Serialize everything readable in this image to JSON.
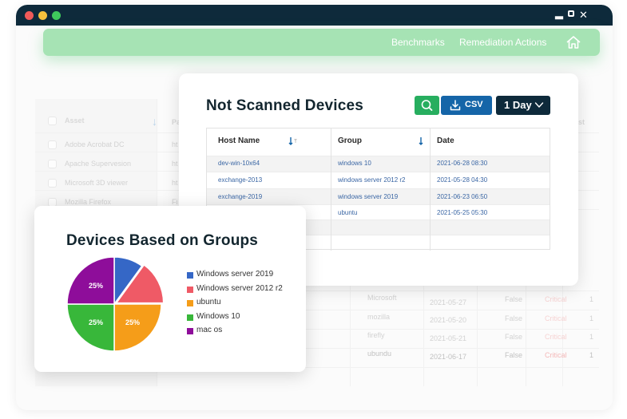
{
  "window": {
    "colors": {
      "titlebar": "#0e2a3b",
      "close": "#f05a59",
      "minimize": "#f7c13d",
      "maximize": "#3fca5c"
    }
  },
  "nav": {
    "benchmarks": "Benchmarks",
    "remediation": "Remediation Actions",
    "home_icon": "home-icon",
    "color": "#a6e3b4"
  },
  "background_table": {
    "headers": {
      "asset": "Asset",
      "pa": "Pa",
      "est": "est"
    },
    "assets": [
      "Adobe Acrobat DC",
      "Apache Supervesion",
      "Microsoft 3D viewer",
      "Mozilla Firefox"
    ],
    "asset_col2": [
      "ht",
      "ht",
      "ht",
      "Fi"
    ],
    "lower_rows": [
      {
        "name": "Microsoft",
        "date": "2021-05-27",
        "flag": "False",
        "severity": "Critical",
        "count": "1"
      },
      {
        "name": "mozilla",
        "date": "2021-05-20",
        "flag": "False",
        "severity": "Critical",
        "count": "1"
      },
      {
        "name": "firefly",
        "date": "2021-05-21",
        "flag": "False",
        "severity": "Critical",
        "count": "1"
      },
      {
        "name": "ubundu",
        "date": "2021-06-17",
        "flag": "False",
        "severity": "Critical",
        "count": "1"
      }
    ]
  },
  "scan_card": {
    "title": "Not Scanned Devices",
    "search_icon": "search-icon",
    "csv_label": "CSV",
    "range_label": "1 Day",
    "colors": {
      "search": "#27ae5f",
      "csv": "#1565a8",
      "range": "#0e2a3b"
    },
    "columns": [
      "Host Name",
      "Group",
      "Date"
    ],
    "rows": [
      {
        "host": "dev-win-10x64",
        "group": "windows 10",
        "date": "2021-06-28   08:30"
      },
      {
        "host": "exchange-2013",
        "group": "windows server 2012 r2",
        "date": "2021-05-28   04:30"
      },
      {
        "host": "exchange-2019",
        "group": "windows server 2019",
        "date": "2021-06-23   06:50"
      },
      {
        "host": "",
        "group": "ubuntu",
        "date": "2021-05-25   05:30"
      }
    ]
  },
  "pie_card": {
    "title": "Devices Based on Groups",
    "chart_data": {
      "type": "pie",
      "slices": [
        {
          "label": "Windows server 2019",
          "value": 10,
          "color": "#3567c6",
          "display": ""
        },
        {
          "label": "Windows server 2012 r2",
          "value": 15,
          "color": "#ef5a66",
          "display": ""
        },
        {
          "label": "ubuntu",
          "value": 25,
          "color": "#f59d19",
          "display": "25%"
        },
        {
          "label": "Windows 10",
          "value": 25,
          "color": "#38b73a",
          "display": "25%"
        },
        {
          "label": "mac os",
          "value": 25,
          "color": "#8e0d9a",
          "display": "25%"
        }
      ],
      "legend": "right"
    }
  }
}
